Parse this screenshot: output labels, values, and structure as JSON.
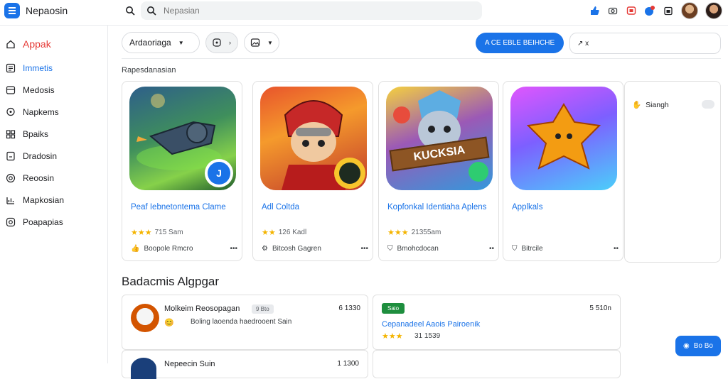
{
  "app": {
    "title": "Nepaosin",
    "logo_letter": "≡"
  },
  "search": {
    "placeholder": "Nepasian"
  },
  "sidebar": {
    "items": [
      {
        "label": "Appak",
        "icon": "home-icon",
        "active": true
      },
      {
        "label": "Immetis",
        "icon": "grid-icon",
        "active": false
      },
      {
        "label": "Medosis",
        "icon": "box-icon",
        "active": false
      },
      {
        "label": "Napkems",
        "icon": "location-icon",
        "active": false
      },
      {
        "label": "Bpaiks",
        "icon": "people-icon",
        "active": false
      },
      {
        "label": "Dradosin",
        "icon": "bookmark-icon",
        "active": false
      },
      {
        "label": "Reoosin",
        "icon": "target-icon",
        "active": false
      },
      {
        "label": "Mapkosian",
        "icon": "chart-icon",
        "active": false
      },
      {
        "label": "Poapapias",
        "icon": "settings-icon",
        "active": false
      }
    ]
  },
  "toolbar": {
    "dropdown_label": "Ardaoriaga",
    "filter2_label": "",
    "primary_button": "A CE EBLE BEIHCHE",
    "side_input": "↗ x"
  },
  "recommendations": {
    "label": "Rapesdanasian",
    "cards": [
      {
        "title": "Peaf Iebnetontema Clame",
        "rating": "715 Sam",
        "footer": "Boopole Rmcro"
      },
      {
        "title": "Adl Coltda",
        "rating": "126 Kadl",
        "footer": "Bitcosh Gagren"
      },
      {
        "title": "Kopfonkal Identiaha Aplens",
        "rating": "21355am",
        "footer": "Bmohcdocan"
      },
      {
        "title": "Applkals",
        "rating": "",
        "footer": "Bitrcile"
      }
    ],
    "side_panel": {
      "label": "Siangh"
    },
    "card3_banner": "KUCKSIA"
  },
  "section2": {
    "title": "Badacmis Algpgar",
    "items": [
      {
        "name": "Molkeim Reosopagan",
        "badge": "9 Bto",
        "price": "6 1330",
        "desc": "Boling laoenda haedrooent Sain"
      },
      {
        "badge": "Saio",
        "price": "5 510n",
        "desc": "Cepanadeel Aaois Pairoenik",
        "rating": "31 1539"
      },
      {
        "name": "Nepeecin Suin",
        "price": "1 1300"
      }
    ]
  },
  "fab": {
    "label": "Bo Bo"
  },
  "colors": {
    "accent": "#1a73e8",
    "active_nav": "#e53935",
    "star": "#f4b400"
  }
}
